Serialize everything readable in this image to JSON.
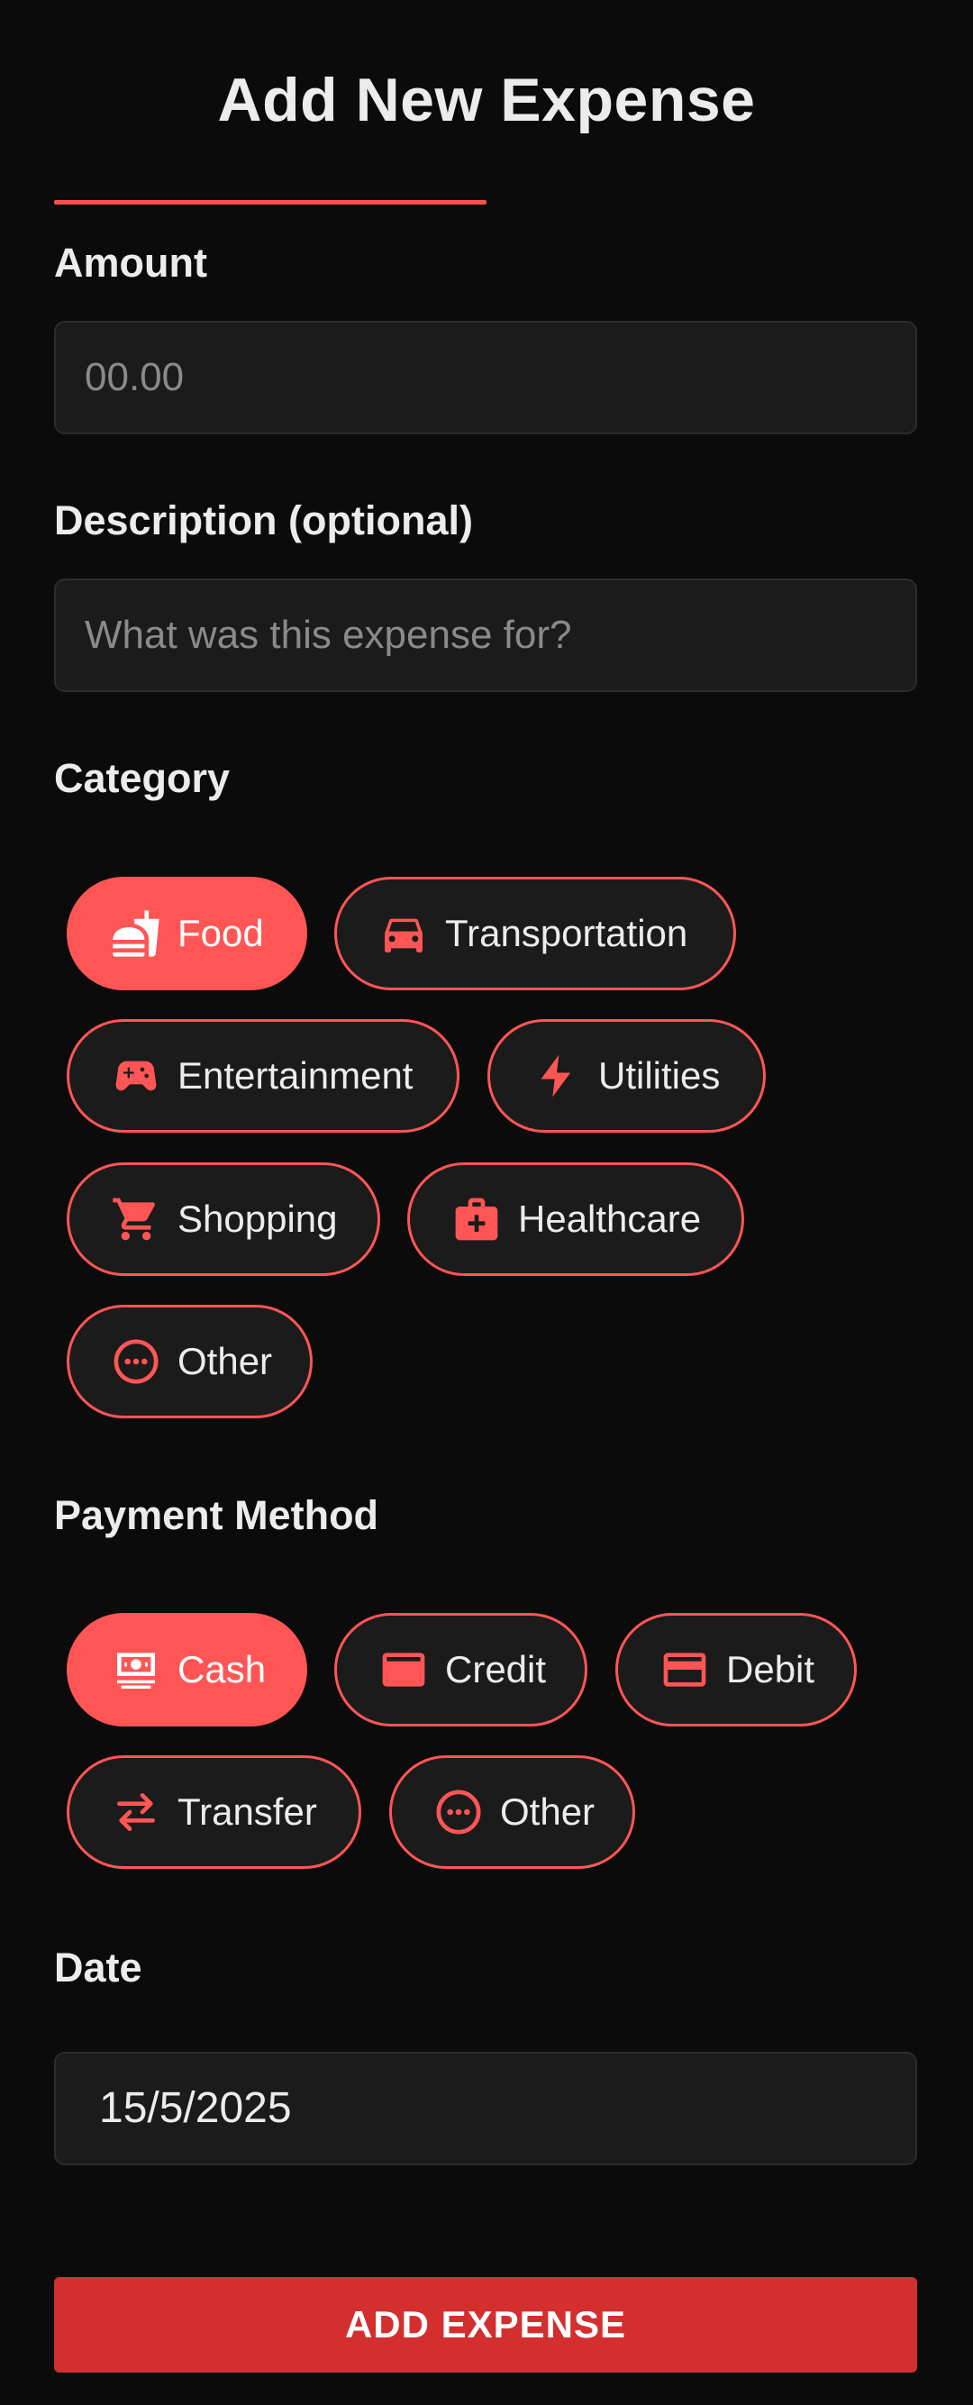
{
  "header": {
    "title": "Add New Expense"
  },
  "amount": {
    "label": "Amount",
    "placeholder": "00.00"
  },
  "description": {
    "label": "Description (optional)",
    "placeholder": "What was this expense for?"
  },
  "category": {
    "label": "Category",
    "selected": "Food",
    "options": [
      {
        "label": "Food",
        "icon": "fastfood-icon"
      },
      {
        "label": "Transportation",
        "icon": "car-icon"
      },
      {
        "label": "Entertainment",
        "icon": "gamepad-icon"
      },
      {
        "label": "Utilities",
        "icon": "lightning-icon"
      },
      {
        "label": "Shopping",
        "icon": "shopping-cart-icon"
      },
      {
        "label": "Healthcare",
        "icon": "medical-bag-icon"
      },
      {
        "label": "Other",
        "icon": "more-horiz-circle-icon"
      }
    ]
  },
  "payment": {
    "label": "Payment Method",
    "selected": "Cash",
    "options": [
      {
        "label": "Cash",
        "icon": "cash-icon"
      },
      {
        "label": "Credit",
        "icon": "credit-card-icon"
      },
      {
        "label": "Debit",
        "icon": "debit-card-icon"
      },
      {
        "label": "Transfer",
        "icon": "transfer-icon"
      },
      {
        "label": "Other",
        "icon": "more-horiz-circle-icon"
      }
    ]
  },
  "date": {
    "label": "Date",
    "value": "15/5/2025"
  },
  "submit": {
    "label": "ADD EXPENSE"
  },
  "colors": {
    "background": "#0b0b0b",
    "accent": "#ff5555",
    "button": "#d32f2f",
    "field": "#1b1b1b"
  }
}
